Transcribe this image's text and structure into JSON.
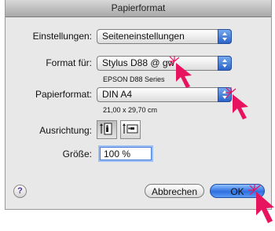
{
  "window": {
    "title": "Papierformat"
  },
  "settings": {
    "label": "Einstellungen:",
    "value": "Seiteneinstellungen"
  },
  "format_for": {
    "label": "Format für:",
    "value": "Stylus D88 @ gw",
    "sub": "EPSON D88 Series"
  },
  "paper": {
    "label": "Papierformat:",
    "value": "DIN A4",
    "sub": "21,00 x 29,70 cm"
  },
  "orientation": {
    "label": "Ausrichtung:",
    "options": [
      "portrait",
      "landscape"
    ],
    "selected": "portrait"
  },
  "size": {
    "label": "Größe:",
    "value": "100 %"
  },
  "buttons": {
    "help": "?",
    "cancel": "Abbrechen",
    "ok": "OK"
  },
  "colors": {
    "accent": "#2f6fe0",
    "annotation": "#e8135f"
  },
  "icons": {
    "help": "help-icon",
    "orient_portrait": "portrait-orientation-icon",
    "orient_landscape": "landscape-orientation-icon",
    "pointer": "pointer-arrow-icon"
  }
}
